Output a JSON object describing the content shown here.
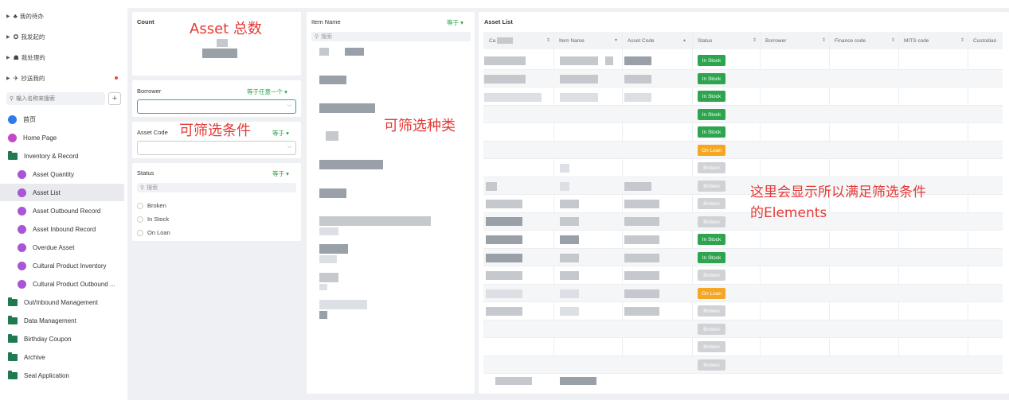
{
  "sidebar": {
    "top_items": [
      {
        "label": "我的待办",
        "icon": "bell-icon",
        "glyph": "♣"
      },
      {
        "label": "我发起的",
        "icon": "send-icon",
        "glyph": "✪"
      },
      {
        "label": "我处理的",
        "icon": "lock-icon",
        "glyph": "☗"
      },
      {
        "label": "抄送我的",
        "icon": "plane-icon",
        "glyph": "✈"
      }
    ],
    "search_placeholder": "输入名称来搜索",
    "plus_label": "+",
    "nav": [
      {
        "label": "首页",
        "icon": "home-icon"
      },
      {
        "label": "Home Page",
        "icon": "home-page-icon"
      },
      {
        "label": "Inventory & Record",
        "icon": "folder-icon"
      },
      {
        "label": "Asset Quantity",
        "icon": "form-icon"
      },
      {
        "label": "Asset List",
        "icon": "form-icon"
      },
      {
        "label": "Asset Outbound Record",
        "icon": "form-icon"
      },
      {
        "label": "Asset Inbound Record",
        "icon": "form-icon"
      },
      {
        "label": "Overdue Asset",
        "icon": "clock-icon"
      },
      {
        "label": "Cultural Product Inventory",
        "icon": "form-icon"
      },
      {
        "label": "Cultural Product Outbound ...",
        "icon": "form-icon"
      },
      {
        "label": "Out/Inbound Management",
        "icon": "folder-icon"
      },
      {
        "label": "Data Management",
        "icon": "folder-icon"
      },
      {
        "label": "Birthday Coupon",
        "icon": "folder-icon"
      },
      {
        "label": "Archive",
        "icon": "folder-icon"
      },
      {
        "label": "Seal Application",
        "icon": "folder-icon"
      }
    ]
  },
  "count_panel": {
    "title": "Count"
  },
  "borrower_filter": {
    "label": "Borrower",
    "operator": "等于任意一个 ▾"
  },
  "asset_code_filter": {
    "label": "Asset Code",
    "operator": "等于 ▾"
  },
  "status_filter": {
    "label": "Status",
    "operator": "等于 ▾",
    "search_placeholder": "搜索",
    "options": [
      "Broken",
      "In Stock",
      "On Loan"
    ]
  },
  "item_name_filter": {
    "label": "Item Name",
    "operator": "等于 ▾",
    "search_placeholder": "搜索"
  },
  "annotations": {
    "asset_total": "Asset 总数",
    "filter_conditions": "可筛选条件",
    "filter_types": "可筛选种类",
    "elements_note_line1": "这里会显示所以满足筛选条件",
    "elements_note_line2": "的Elements"
  },
  "asset_list": {
    "title": "Asset List",
    "columns": [
      "Ca",
      "Item Name",
      "Asset Code",
      "Status",
      "Borrower",
      "Finance code",
      "MITS code",
      "Custodian"
    ],
    "statuses": [
      "In Stock",
      "In Stock",
      "In Stock",
      "In Stock",
      "In Stock",
      "On Loan",
      "Broken",
      "Broken",
      "Broken",
      "Broken",
      "In Stock",
      "In Stock",
      "Broken",
      "On Loan",
      "Broken",
      "Broken",
      "Broken",
      "Broken"
    ]
  },
  "colors": {
    "in_stock": "#2ea44f",
    "on_loan": "#f5a623",
    "broken": "#d0d2d6",
    "filter_link": "#27a148",
    "annotation": "#e53935"
  }
}
